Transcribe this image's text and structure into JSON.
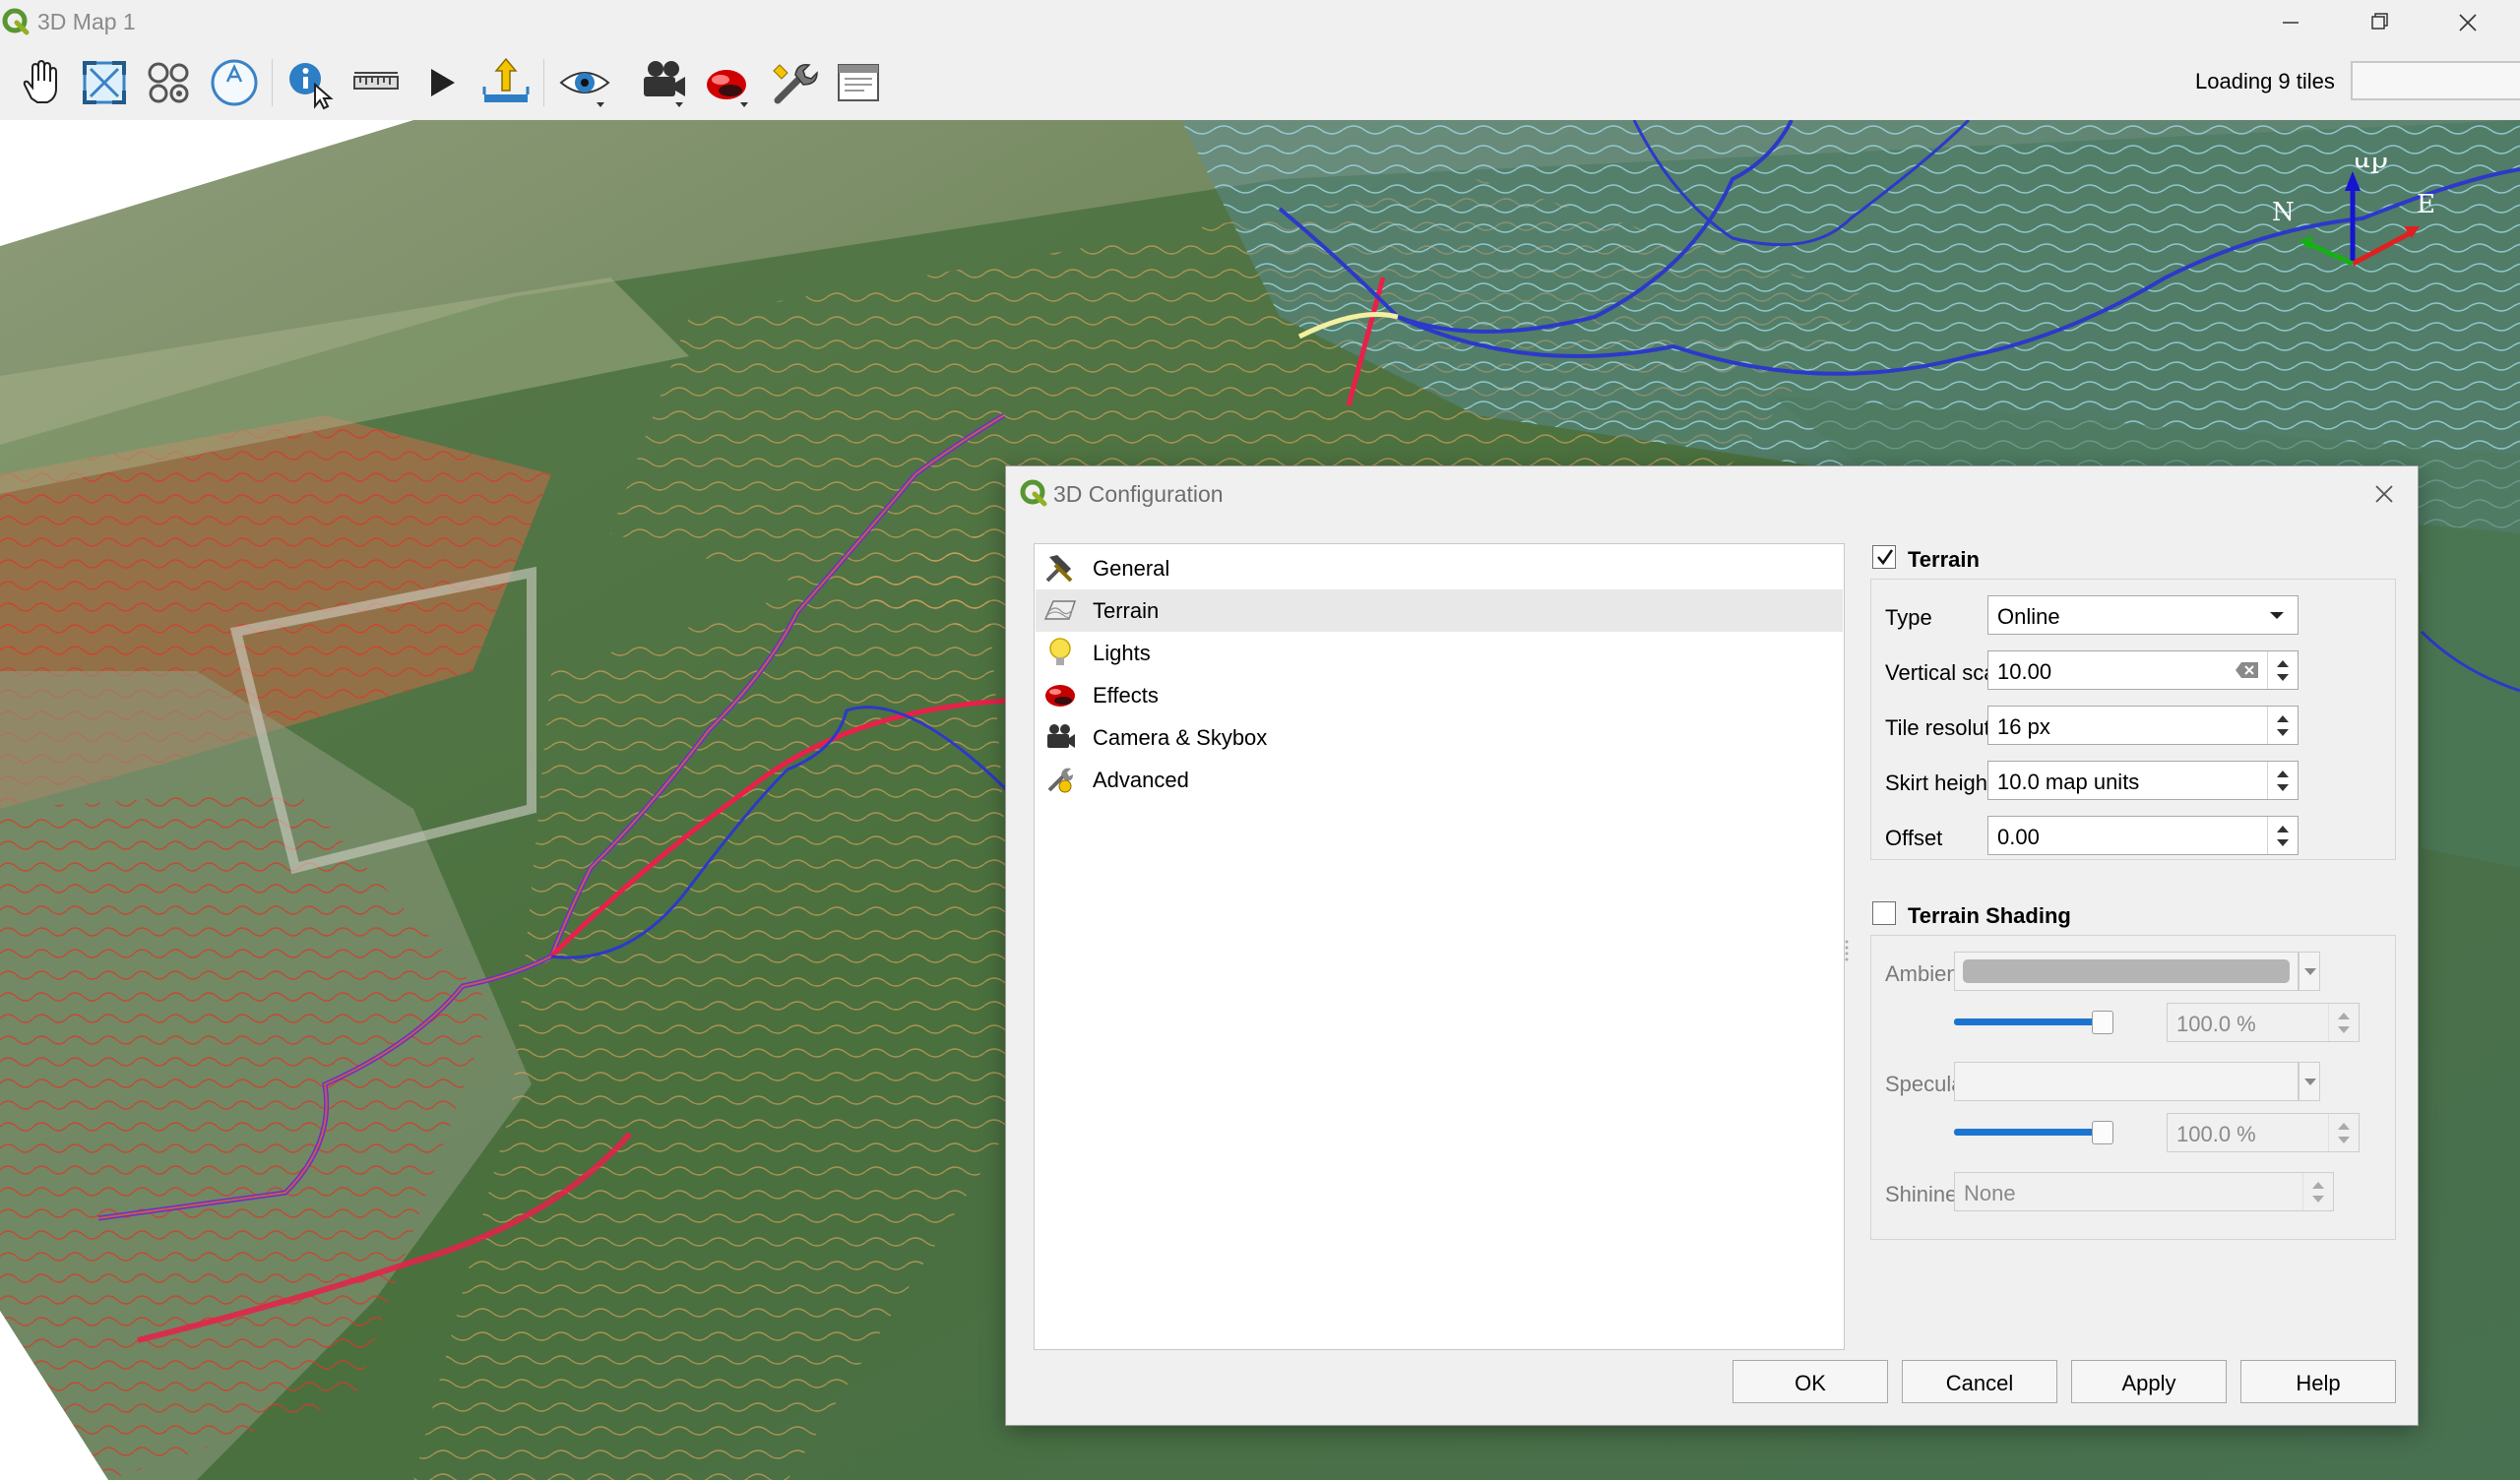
{
  "window": {
    "title": "3D Map 1"
  },
  "toolbar": {
    "buttons": [
      {
        "icon": "pan-hand-icon",
        "tooltip": "Pan"
      },
      {
        "icon": "zoom-full-icon",
        "tooltip": "Zoom Full"
      },
      {
        "icon": "toggle-on-screen-nav-icon",
        "tooltip": "Toggle On-Screen Navigation"
      },
      {
        "icon": "north-arrow-icon",
        "tooltip": "North"
      },
      {
        "icon": "identify-icon",
        "tooltip": "Identify"
      },
      {
        "icon": "measure-icon",
        "tooltip": "Measurement Line"
      },
      {
        "icon": "play-animation-icon",
        "tooltip": "Animations"
      },
      {
        "icon": "export-scene-icon",
        "tooltip": "Export 3D Scene"
      },
      {
        "icon": "camera-view-icon",
        "tooltip": "Camera"
      },
      {
        "icon": "camera-skybox-icon",
        "tooltip": "Camera & Skybox"
      },
      {
        "icon": "effects-icon",
        "tooltip": "Effects"
      },
      {
        "icon": "configure-wrench-icon",
        "tooltip": "Configure"
      },
      {
        "icon": "dock-window-icon",
        "tooltip": "Dock"
      }
    ],
    "status": "Loading 9 tiles",
    "progress_fraction": 0
  },
  "compass": {
    "north": "N",
    "up": "up",
    "east": "E"
  },
  "dialog": {
    "title": "3D Configuration",
    "list": [
      {
        "label": "General",
        "icon": "hammer-icon"
      },
      {
        "label": "Terrain",
        "icon": "terrain-icon"
      },
      {
        "label": "Lights",
        "icon": "lightbulb-icon"
      },
      {
        "label": "Effects",
        "icon": "effects-icon"
      },
      {
        "label": "Camera & Skybox",
        "icon": "camera-icon"
      },
      {
        "label": "Advanced",
        "icon": "advanced-icon"
      }
    ],
    "selected_index": 1,
    "terrain": {
      "title": "Terrain",
      "checked": true,
      "type_label": "Type",
      "type_value": "Online",
      "vertical_scale_label": "Vertical scale",
      "vertical_scale_value": "10.00",
      "tile_resolution_label": "Tile resolution",
      "tile_resolution_value": "16 px",
      "skirt_height_label": "Skirt height",
      "skirt_height_value": "10.0 map units",
      "offset_label": "Offset",
      "offset_value": "0.00"
    },
    "shading": {
      "title": "Terrain Shading",
      "checked": false,
      "ambient_label": "Ambient",
      "ambient_color": "#b4b4b4",
      "ambient_opacity": "100.0 %",
      "ambient_opacity_fraction": 1.0,
      "specular_label": "Specular",
      "specular_color": "#f3f3f3",
      "specular_opacity": "100.0 %",
      "specular_opacity_fraction": 1.0,
      "shininess_label": "Shininess",
      "shininess_value": "None"
    },
    "buttons": {
      "ok": "OK",
      "cancel": "Cancel",
      "apply": "Apply",
      "help": "Help"
    }
  },
  "colors": {
    "slider_accent": "#1a74d0",
    "axis_up": "#1414d2",
    "axis_east": "#e02020",
    "axis_north": "#16b016"
  }
}
